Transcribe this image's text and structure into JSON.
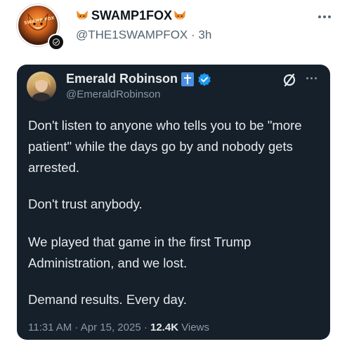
{
  "post": {
    "display_name": "SWAMP1FOX",
    "handle": "@THE1SWAMPFOX",
    "separator": "·",
    "time_ago": "3h",
    "avatar_text": "SWAMP FOX"
  },
  "embedded_tweet": {
    "display_name": "Emerald Robinson",
    "handle": "@EmeraldRobinson",
    "paragraphs": [
      "Don't listen to anyone who tells you to be \"more patient\" while the days go by and nobody gets arrested.",
      "Don't trust anybody.",
      "We played that game in the first Trump Administration, and we lost.",
      "Demand results. Every day."
    ],
    "timestamp": "11:31 AM · Apr 15, 2025 · ",
    "views_count": "12.4K",
    "views_label": " Views"
  },
  "colors": {
    "card_background": "#15202b",
    "verified_blue": "#1d9bf0",
    "secondary_text": "#536471"
  },
  "icons": [
    "fox-emoji-icon",
    "more-options-icon",
    "cross-badge-icon",
    "verified-badge-icon",
    "grok-icon"
  ]
}
